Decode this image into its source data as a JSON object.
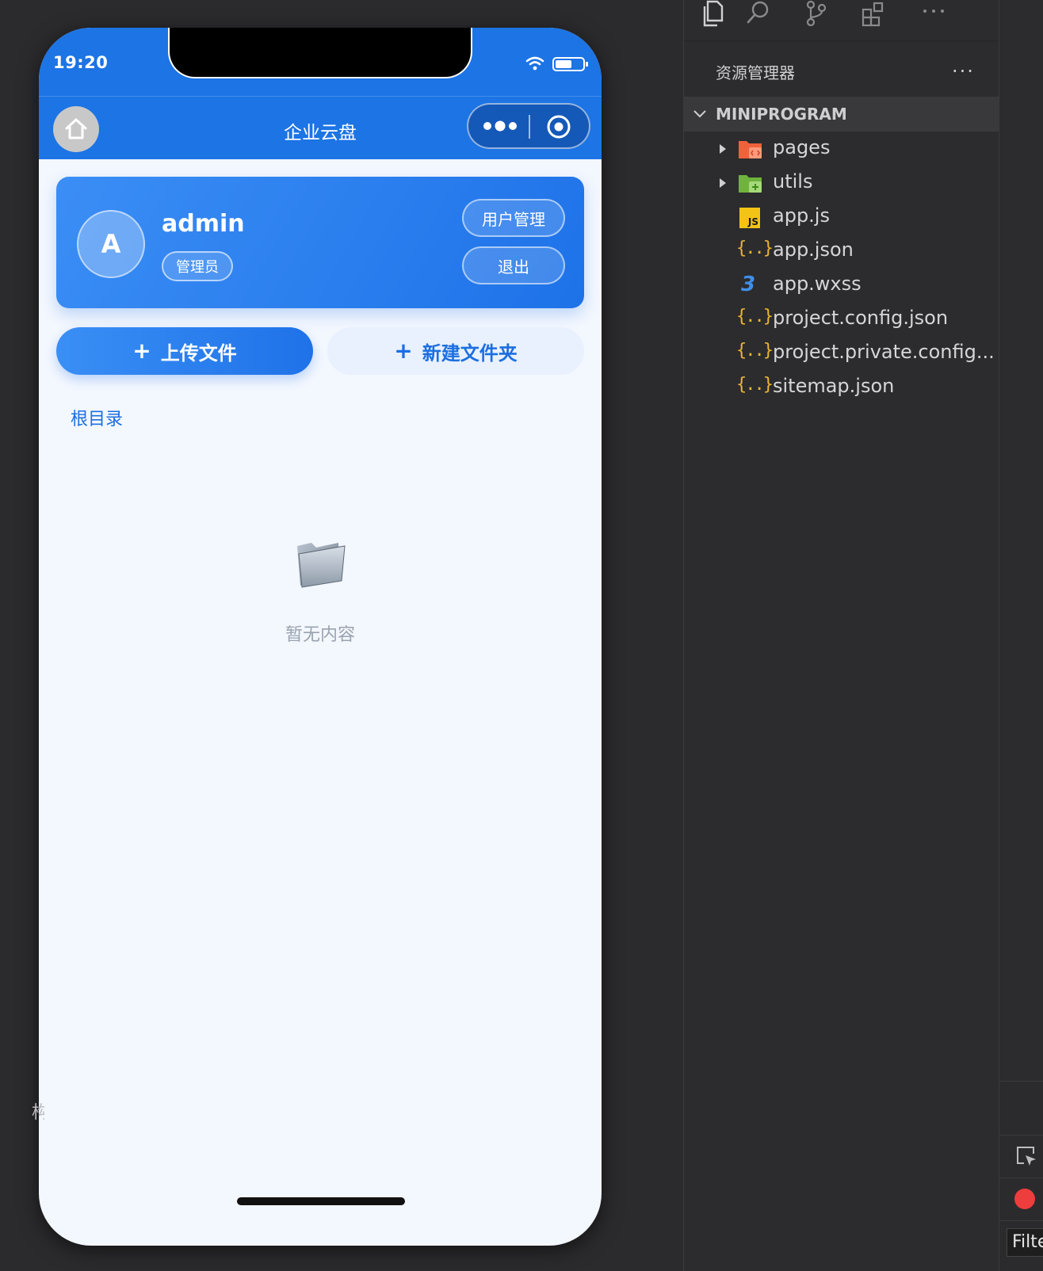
{
  "status_bar": {
    "time": "19:20"
  },
  "nav": {
    "title": "企业云盘"
  },
  "user": {
    "avatar_letter": "A",
    "name": "admin",
    "role": "管理员",
    "manage_label": "用户管理",
    "logout_label": "退出"
  },
  "actions": {
    "upload_label": "上传文件",
    "new_folder_label": "新建文件夹",
    "plus": "+"
  },
  "breadcrumb": "根目录",
  "empty": {
    "text": "暂无内容",
    "icon": "folder-icon"
  },
  "explorer": {
    "title": "资源管理器",
    "more": "···",
    "section": "MINIPROGRAM",
    "items": [
      {
        "label": "pages",
        "type": "folder",
        "icon": "pages-folder-icon"
      },
      {
        "label": "utils",
        "type": "folder",
        "icon": "utils-folder-icon"
      },
      {
        "label": "app.js",
        "type": "js",
        "icon": "js-file-icon"
      },
      {
        "label": "app.json",
        "type": "json",
        "icon": "json-file-icon"
      },
      {
        "label": "app.wxss",
        "type": "css",
        "icon": "css-file-icon"
      },
      {
        "label": "project.config.json",
        "type": "json",
        "icon": "json-file-icon"
      },
      {
        "label": "project.private.config...",
        "type": "json",
        "icon": "json-file-icon"
      },
      {
        "label": "sitemap.json",
        "type": "json",
        "icon": "json-file-icon"
      }
    ]
  },
  "side_panel": {
    "truncated_label": "构",
    "filter_placeholder": "Filte"
  },
  "colors": {
    "brand_blue": "#1c74e5",
    "page_bg": "#f3f7fe",
    "ide_bg": "#2c2c2e",
    "json_yellow": "#e8b530"
  }
}
